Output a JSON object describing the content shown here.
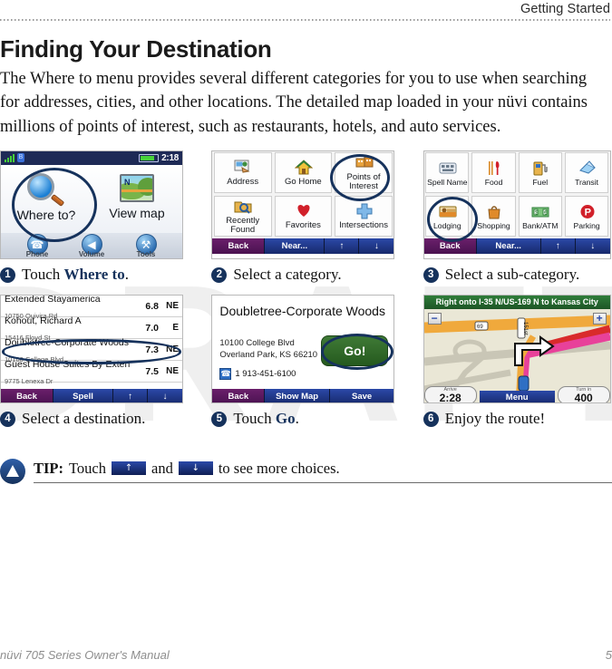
{
  "header": {
    "running_head": "Getting Started"
  },
  "section": {
    "heading": "Finding Your Destination",
    "body": "The Where to menu provides several different categories for you to use when searching for addresses, cities, and other locations. The detailed map loaded in your nüvi contains millions of points of interest, such as restaurants, hotels, and auto services."
  },
  "watermark": {
    "text": "DRAFT"
  },
  "steps": [
    {
      "number": "1",
      "caption_pre": "Touch ",
      "caption_strong": "Where to",
      "caption_post": "."
    },
    {
      "number": "2",
      "caption_pre": "Select a category.",
      "caption_strong": "",
      "caption_post": ""
    },
    {
      "number": "3",
      "caption_pre": "Select a sub-category.",
      "caption_strong": "",
      "caption_post": ""
    },
    {
      "number": "4",
      "caption_pre": "Select a destination.",
      "caption_strong": "",
      "caption_post": ""
    },
    {
      "number": "5",
      "caption_pre": "Touch ",
      "caption_strong": "Go",
      "caption_post": "."
    },
    {
      "number": "6",
      "caption_pre": "Enjoy the route!",
      "caption_strong": "",
      "caption_post": ""
    }
  ],
  "screen_home": {
    "status": {
      "time": "2:18",
      "signal_icon": "signal-bars-icon",
      "bluetooth_icon": "bluetooth-icon",
      "battery_icon": "battery-icon"
    },
    "where_to_label": "Where to?",
    "view_map_label": "View map",
    "tools": [
      {
        "label": "Phone",
        "icon": "phone-icon",
        "glyph": "☎"
      },
      {
        "label": "Volume",
        "icon": "volume-icon",
        "glyph": "◀"
      },
      {
        "label": "Tools",
        "icon": "wrench-icon",
        "glyph": "⚒"
      }
    ]
  },
  "screen_categories": {
    "items": [
      {
        "label": "Address",
        "icon": "address-icon"
      },
      {
        "label": "Go Home",
        "icon": "home-icon"
      },
      {
        "label": "Points of Interest",
        "icon": "points-of-interest-icon",
        "selected": true
      },
      {
        "label": "Recently Found",
        "icon": "recently-found-icon"
      },
      {
        "label": "Favorites",
        "icon": "heart-icon"
      },
      {
        "label": "Intersections",
        "icon": "intersection-icon"
      }
    ],
    "navbar": {
      "back": "Back",
      "mid": "Near...",
      "up": "↑",
      "down": "↓"
    }
  },
  "screen_subcategories": {
    "items": [
      {
        "label": "Spell Name",
        "icon": "spell-name-icon"
      },
      {
        "label": "Food",
        "icon": "food-icon"
      },
      {
        "label": "Fuel",
        "icon": "fuel-icon"
      },
      {
        "label": "Transit",
        "icon": "transit-icon"
      },
      {
        "label": "Lodging",
        "icon": "lodging-icon",
        "selected": true
      },
      {
        "label": "Shopping",
        "icon": "shopping-icon"
      },
      {
        "label": "Bank/ATM",
        "icon": "bank-atm-icon"
      },
      {
        "label": "Parking",
        "icon": "parking-icon"
      }
    ],
    "navbar": {
      "back": "Back",
      "mid": "Near...",
      "up": "↑",
      "down": "↓"
    }
  },
  "screen_results": {
    "rows": [
      {
        "name": "Extended Stayamerica",
        "address": "10750 Quivira Rd",
        "distance": "6.8",
        "direction": "NE"
      },
      {
        "name": "Kohout, Richard A",
        "address": "15416 Floyd St",
        "distance": "7.0",
        "direction": "E"
      },
      {
        "name": "Doubletree-Corporate Woods",
        "address": "10100 College Blvd",
        "distance": "7.3",
        "direction": "NE",
        "selected": true
      },
      {
        "name": "Guest House Suites By Extended",
        "address": "9775 Lenexa Dr",
        "distance": "7.5",
        "direction": "NE"
      }
    ],
    "navbar": {
      "back": "Back",
      "mid": "Spell",
      "up": "↑",
      "down": "↓"
    }
  },
  "screen_detail": {
    "title": "Doubletree-Corporate Woods",
    "address_line1": "10100 College Blvd",
    "address_line2": "Overland Park, KS 66210",
    "phone": "1 913-451-6100",
    "phone_icon": "phone-icon",
    "go_label": "Go!",
    "navbar": {
      "back": "Back",
      "show_map": "Show Map",
      "save": "Save"
    }
  },
  "screen_map": {
    "banner": "Right onto I-35 N/US-169 N to Kansas City",
    "zoom_out": "−",
    "zoom_in": "+",
    "arrive_label": "Arrive",
    "arrive_value": "2:28",
    "menu_label": "Menu",
    "turn_label": "Turn in",
    "turn_value": "400",
    "turn_unit": "ft",
    "shield_1": "69",
    "shield_2": "151st"
  },
  "tip": {
    "logo_icon": "garmin-logo-icon",
    "label": "TIP:",
    "text_before": "Touch",
    "up_glyph": "↑",
    "and_text": "and",
    "down_glyph": "↓",
    "text_after": "to see more choices."
  },
  "footer": {
    "title": "nüvi 705 Series Owner's Manual",
    "page": "5"
  }
}
